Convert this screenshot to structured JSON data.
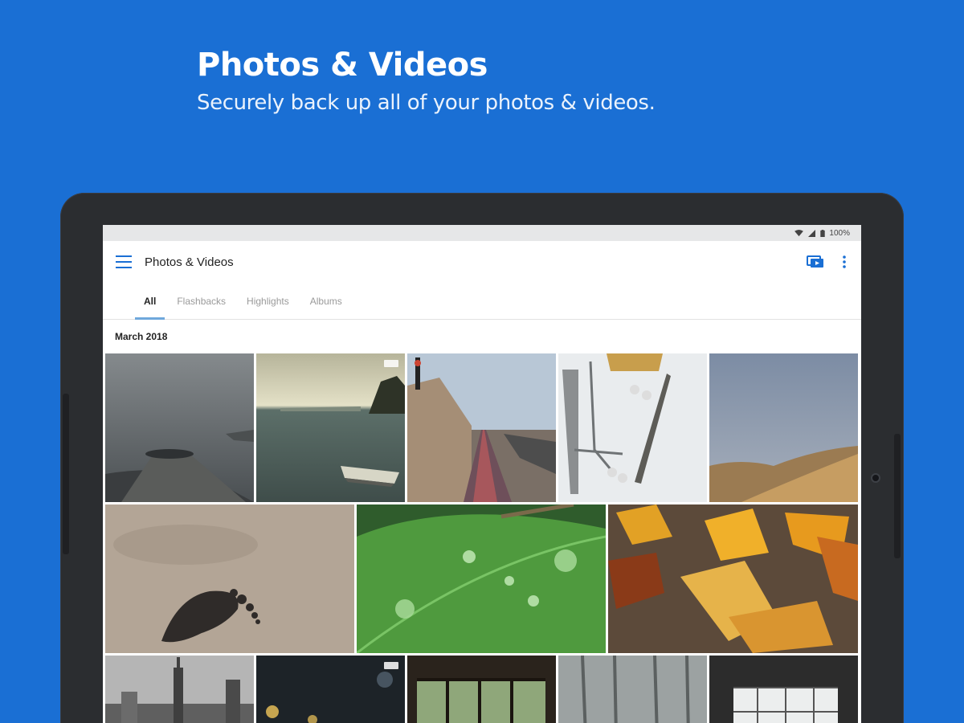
{
  "promo": {
    "title": "Photos & Videos",
    "subtitle": "Securely back up all of your photos & videos."
  },
  "colors": {
    "background": "#1a6fd4",
    "accent": "#1a6fd4",
    "tab_indicator": "#6fa8dc"
  },
  "statusbar": {
    "battery": "100%"
  },
  "app": {
    "title": "Photos & Videos",
    "menu_icon": "hamburger-menu-icon",
    "actions": [
      "cast-slideshow-icon",
      "more-vert-icon"
    ]
  },
  "tabs": [
    {
      "label": "All",
      "active": true
    },
    {
      "label": "Flashbacks",
      "active": false
    },
    {
      "label": "Highlights",
      "active": false
    },
    {
      "label": "Albums",
      "active": false
    }
  ],
  "section": {
    "date": "March 2018"
  },
  "photos": [
    {
      "subject": "foggy-pier",
      "video": false
    },
    {
      "subject": "sea-boat",
      "video": true
    },
    {
      "subject": "railway-tracks",
      "video": false
    },
    {
      "subject": "skateboard",
      "video": false
    },
    {
      "subject": "desert-dunes",
      "video": false
    },
    {
      "subject": "footprint-sand",
      "video": false
    },
    {
      "subject": "leaf-water-drops",
      "video": false
    },
    {
      "subject": "autumn-leaves",
      "video": false
    },
    {
      "subject": "city-skyline",
      "video": false
    },
    {
      "subject": "night-bokeh",
      "video": true
    },
    {
      "subject": "window-view",
      "video": false
    },
    {
      "subject": "misty-forest",
      "video": false
    },
    {
      "subject": "bright-windows",
      "video": false
    }
  ]
}
